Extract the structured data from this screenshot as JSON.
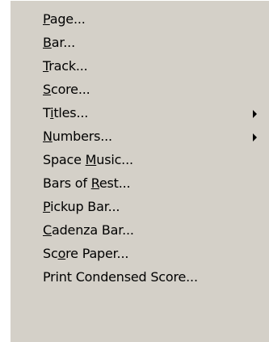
{
  "menu": {
    "items": [
      {
        "id": "page",
        "pre": "",
        "key": "P",
        "post": "age...",
        "submenu": false
      },
      {
        "id": "bar",
        "pre": "",
        "key": "B",
        "post": "ar...",
        "submenu": false
      },
      {
        "id": "track",
        "pre": "",
        "key": "T",
        "post": "rack...",
        "submenu": false
      },
      {
        "id": "score",
        "pre": "",
        "key": "S",
        "post": "core...",
        "submenu": false
      },
      {
        "id": "titles",
        "pre": "T",
        "key": "i",
        "post": "tles...",
        "submenu": true
      },
      {
        "id": "numbers",
        "pre": "",
        "key": "N",
        "post": "umbers...",
        "submenu": true
      },
      {
        "id": "space-music",
        "pre": "Space ",
        "key": "M",
        "post": "usic...",
        "submenu": false
      },
      {
        "id": "bars-of-rest",
        "pre": "Bars of ",
        "key": "R",
        "post": "est...",
        "submenu": false
      },
      {
        "id": "pickup-bar",
        "pre": "",
        "key": "P",
        "post": "ickup Bar...",
        "submenu": false
      },
      {
        "id": "cadenza-bar",
        "pre": "",
        "key": "C",
        "post": "adenza Bar...",
        "submenu": false
      },
      {
        "id": "score-paper",
        "pre": "Sc",
        "key": "o",
        "post": "re Paper...",
        "submenu": false
      },
      {
        "id": "print-condensed-score",
        "pre": "Print Condensed Score...",
        "key": "",
        "post": "",
        "submenu": false
      }
    ]
  },
  "colors": {
    "menu_background": "#d4d0c8",
    "text": "#000000",
    "highlight": "#ffffff"
  },
  "icons": {
    "submenu": "submenu-arrow-icon"
  }
}
